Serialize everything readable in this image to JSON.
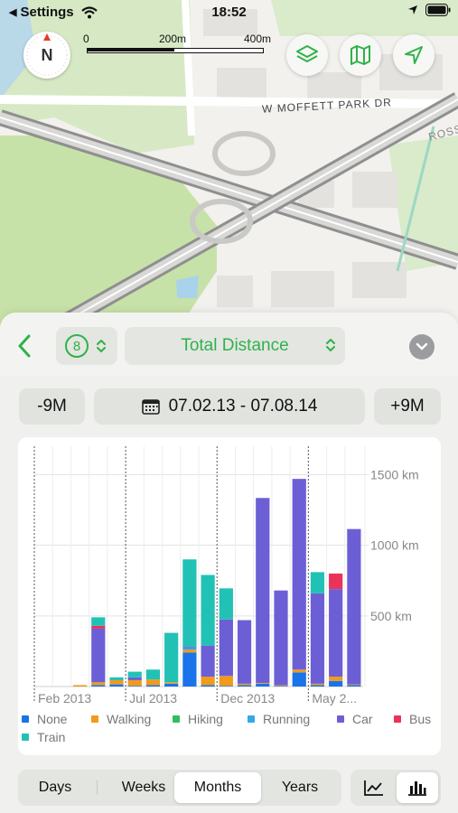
{
  "status_bar": {
    "back_app": "Settings",
    "time": "18:52"
  },
  "map": {
    "compass_label": "N",
    "scale_labels": [
      "0",
      "200m",
      "400m"
    ],
    "road_labels": [
      "W MOFFETT PARK DR",
      "ROSS"
    ],
    "buttons": [
      "layers-icon",
      "map-icon",
      "location-arrow-icon"
    ]
  },
  "header": {
    "count": "8",
    "metric": "Total Distance"
  },
  "range": {
    "prev_label": "-9M",
    "date_label": "07.02.13 - 07.08.14",
    "next_label": "+9M"
  },
  "chart_data": {
    "type": "bar",
    "stacked": true,
    "x_tick_labels": [
      "Feb 2013",
      "Jul 2013",
      "Dec 2013",
      "May 2..."
    ],
    "y_tick_labels": [
      "1500 km",
      "1000 km",
      "500 km"
    ],
    "y_ticks": [
      1500,
      1000,
      500
    ],
    "ylim": [
      0,
      1500
    ],
    "categories": [
      "Feb 2013",
      "Mar 2013",
      "Apr 2013",
      "May 2013",
      "Jun 2013",
      "Jul 2013",
      "Aug 2013",
      "Sep 2013",
      "Oct 2013",
      "Nov 2013",
      "Dec 2013",
      "Jan 2014",
      "Feb 2014",
      "Mar 2014",
      "Apr 2014",
      "May 2014",
      "Jun 2014",
      "Jul 2014"
    ],
    "series": [
      {
        "name": "None",
        "color": "#1a73e8",
        "values": [
          0,
          0,
          0,
          10,
          15,
          5,
          10,
          20,
          240,
          10,
          5,
          10,
          20,
          5,
          100,
          10,
          40,
          10
        ]
      },
      {
        "name": "Walking",
        "color": "#f19a1c",
        "values": [
          0,
          0,
          10,
          20,
          30,
          40,
          40,
          10,
          20,
          60,
          70,
          10,
          5,
          5,
          20,
          10,
          30,
          5
        ]
      },
      {
        "name": "Hiking",
        "color": "#2fbf5a",
        "values": [
          0,
          0,
          0,
          0,
          0,
          0,
          0,
          0,
          0,
          0,
          0,
          0,
          0,
          0,
          0,
          0,
          0,
          0
        ]
      },
      {
        "name": "Running",
        "color": "#35a9e6",
        "values": [
          0,
          0,
          0,
          0,
          0,
          0,
          0,
          0,
          10,
          0,
          0,
          0,
          0,
          0,
          0,
          0,
          0,
          0
        ]
      },
      {
        "name": "Car",
        "color": "#6c5fd6",
        "values": [
          0,
          0,
          0,
          380,
          0,
          20,
          0,
          0,
          10,
          220,
          400,
          450,
          1310,
          670,
          1350,
          640,
          620,
          1100
        ]
      },
      {
        "name": "Bus",
        "color": "#e9335a",
        "values": [
          0,
          0,
          0,
          20,
          0,
          0,
          0,
          0,
          0,
          0,
          0,
          0,
          0,
          0,
          0,
          0,
          110,
          0
        ]
      },
      {
        "name": "Train",
        "color": "#21c2b5",
        "values": [
          0,
          0,
          0,
          60,
          20,
          40,
          70,
          350,
          620,
          500,
          220,
          0,
          0,
          0,
          0,
          150,
          0,
          0
        ]
      }
    ],
    "grid": true,
    "legend_placement": "bottom"
  },
  "segments": {
    "items": [
      "Days",
      "Weeks",
      "Months",
      "Years"
    ],
    "active": "Months"
  },
  "view_modes": {
    "items": [
      "line-chart-icon",
      "bar-chart-icon"
    ],
    "active": "bar-chart-icon"
  }
}
